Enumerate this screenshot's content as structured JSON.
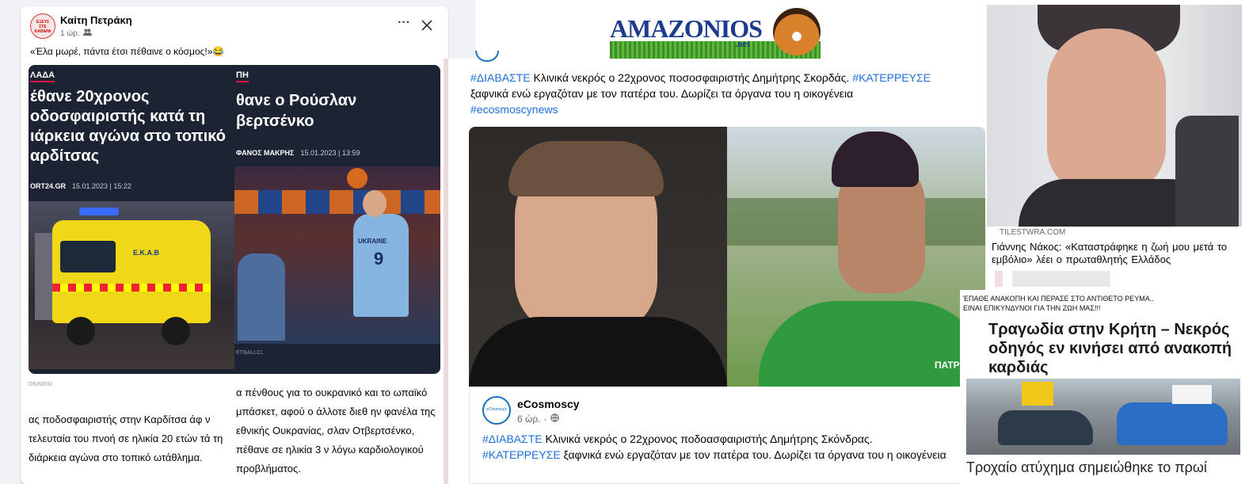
{
  "post1": {
    "author": "Καίτη Πετράκη",
    "time": "1 ώρ.",
    "caption": "«Έλα μωρέ, πάντα έτσι πέθαινε ο κόσμος!»😂",
    "avatar_text": "ΕΞΕΥΣ ΣΤΕ ΚΑΘΑΡΑ",
    "left_article": {
      "category": "ΛΑΔΑ",
      "title": "έθανε 20χρονος οδοσφαιριστής κατά τη ιάρκεια αγώνα στο τοπικό αρδίτσας",
      "source_date": "ORT24.GR",
      "date": "15.01.2023 | 15:22",
      "photo_credit": "OKINISSI",
      "ambulance_label": "Ε.Κ.Α.Β",
      "body": "ας ποδοσφαιριστής στην Καρδίτσα άφ ν τελευταία του πνοή σε ηλικία 20 ετών τά τη διάρκεια αγώνα στο τοπικό ωτάθλημα."
    },
    "right_article": {
      "category": "ΠΗ",
      "title": "θανε ο Ρούσλαν βερτσένκο",
      "author": "ΦΑΝΟΣ ΜΑΚΡΗΣ",
      "date": "15.01.2023 | 13:59",
      "photo_credit": "ETBALLCL",
      "jersey_text": "UKRAINE",
      "jersey_number": "9",
      "body": "α πένθους για το ουκρανικό και το ωπαϊκό μπάσκετ, αφού ο άλλοτε διεθ ην φανέλα της εθνικής Ουκρανίας, σλαν Οτβερτσένκο, πέθανε σε ηλικία 3 ν λόγω καρδιολογικού προβλήματος."
    }
  },
  "post2": {
    "logo_main": "AMAZONIOS",
    "logo_sub": ".net",
    "text_top": {
      "hashtag1": "#ΔΙΑΒΑΣΤΕ",
      "line1": " Κλινικά νεκρός ο 22χρονος ποσοσφαιριστής Δημήτρης Σκορδάς. ",
      "hashtag2": "#ΚΑΤΕΡΡΕΥΣΕ",
      "line2": "ξαφνικά ενώ εργαζόταν με τον πατέρα του. Δωρίζει τα όργανα του η οικογένεια",
      "hashtag3": "#ecosmoscynews"
    },
    "page_name": "eCosmoscy",
    "avatar_text": "eCosmoscy",
    "time": "6 ώρ.",
    "jersey_text": "ΠΑΤΡ",
    "text_bottom": {
      "hashtag1": "#ΔΙΑΒΑΣΤΕ",
      "line1": " Κλινικά νεκρός ο 22χρονος ποδοασφαιριστής Δημήτρης Σκόνδρας.",
      "hashtag2": "#ΚΑΤΕΡΡΕΥΣΕ",
      "line2": " ξαφνικά ενώ εργαζόταν με τον πατέρα του. Δωρίζει τα όργανα του η οικογένεια"
    }
  },
  "right": {
    "source": "TILESTWRA.COM",
    "headline": "Γιάννης Νάκος: «Καταστράφηκε η ζωή μου μετά το εμβόλιο» λέει ο πρωταθλητής Ελλάδος",
    "caption_line1": "ΈΠΑΘΕ ΑΝΑΚΟΠΗ ΚΑΙ ΠΕΡΑΣΕ ΣΤΟ ΑΝΤΙΘΕΤΟ ΡΕΥΜΑ..",
    "caption_line2": "ΕΙΝΑΙ ΕΠΙΚΥΝΔΥΝΟΙ ΓΙΑ ΤΗΝ ΖΩΗ ΜΑΣ!!!",
    "title2": "Τραγωδία στην Κρήτη – Νεκρός οδηγός εν κινήσει από ανακοπή καρδιάς",
    "bottom_text": "Τροχαίο ατύχημα σημειώθηκε το πρωί"
  },
  "colors": {
    "link": "#216fdb",
    "fb_bg": "#f0f2f5",
    "article_dark": "#1c2434",
    "category_red": "#e4144a"
  }
}
